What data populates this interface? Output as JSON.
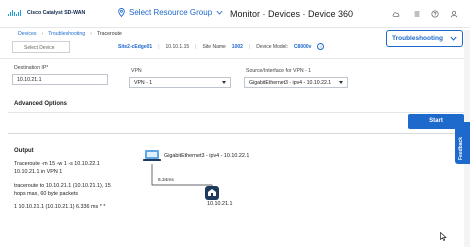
{
  "header": {
    "logo_text": "Cisco Catalyst SD-WAN",
    "resource_group": "Select Resource Group",
    "title": "Monitor · Devices · Device 360"
  },
  "breadcrumb": {
    "items": [
      "Devices",
      "Troubleshooting",
      "Traceroute"
    ]
  },
  "device": {
    "select_placeholder": "Select Device",
    "name": "Site2-cEdge01",
    "ip": "10.10.1.15",
    "site_name_label": "Site Name",
    "site_name_value": "1002",
    "model_label": "Device Model:",
    "model_value": "C8000v"
  },
  "troubleshooting_button": "Troubleshooting",
  "form": {
    "destination_label": "Destination IP*",
    "destination_value": "10.10.21.1",
    "vpn_label": "VPN",
    "vpn_value": "VPN - 1",
    "source_label": "Source/Interface for VPN - 1",
    "source_value": "GigabitEthernet3 - ipv4 - 10.10.22.1",
    "advanced_options": "Advanced Options",
    "start_button": "Start"
  },
  "output": {
    "title": "Output",
    "lines": [
      "Traceroute -m 15 -w 1 -s 10.10.22.1",
      "10.10.21.1 in VPN 1",
      "traceroute to 10.10.21.1 (10.10.21.1), 15",
      "hops max, 60 byte packets",
      "1 10.10.21.1 (10.10.21.1) 6.336 ms * *"
    ],
    "source_node": "GigabitEthernet3 - ipv4 - 10.10.22.1",
    "latency": "6.34ms",
    "dest_node": "10.10.21.1"
  },
  "feedback_tab": "Feedback",
  "colors": {
    "accent": "#1d69cc",
    "node_dark": "#1f3a5f",
    "node_light": "#5fa8e6"
  }
}
